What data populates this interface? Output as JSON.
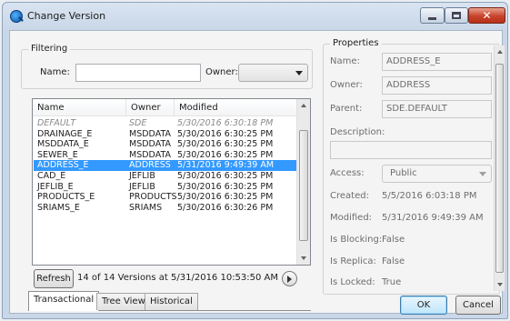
{
  "window": {
    "title": "Change Version",
    "colors": {
      "accent": "#3399ff",
      "close": "#c7432a",
      "titlebar": "#c9d7e8"
    }
  },
  "filtering": {
    "legend": "Filtering",
    "name_label": "Name:",
    "name_value": "",
    "owner_label": "Owner:",
    "owner_value": ""
  },
  "versions": {
    "columns": [
      "Name",
      "Owner",
      "Modified"
    ],
    "rows": [
      {
        "name": "DEFAULT",
        "owner": "SDE",
        "modified": "5/30/2016 6:30:18 PM",
        "style": "italic"
      },
      {
        "name": "DRAINAGE_E",
        "owner": "MSDDATA",
        "modified": "5/30/2016 6:30:25 PM",
        "style": "normal"
      },
      {
        "name": "MSDDATA_E",
        "owner": "MSDDATA",
        "modified": "5/30/2016 6:30:25 PM",
        "style": "normal"
      },
      {
        "name": "SEWER_E",
        "owner": "MSDDATA",
        "modified": "5/30/2016 6:30:25 PM",
        "style": "normal"
      },
      {
        "name": "ADDRESS_E",
        "owner": "ADDRESS",
        "modified": "5/31/2016 9:49:39 AM",
        "style": "selected"
      },
      {
        "name": "CAD_E",
        "owner": "JEFLIB",
        "modified": "5/30/2016 6:30:25 PM",
        "style": "normal"
      },
      {
        "name": "JEFLIB_E",
        "owner": "JEFLIB",
        "modified": "5/30/2016 6:30:25 PM",
        "style": "normal"
      },
      {
        "name": "PRODUCTS_E",
        "owner": "PRODUCTS",
        "modified": "5/30/2016 6:30:25 PM",
        "style": "normal"
      },
      {
        "name": "SRIAMS_E",
        "owner": "SRIAMS",
        "modified": "5/30/2016 6:30:26 PM",
        "style": "normal"
      }
    ]
  },
  "status": {
    "refresh_label": "Refresh",
    "summary": "14 of 14 Versions at 5/31/2016 10:53:50 AM"
  },
  "tabs": [
    {
      "label": "Transactional",
      "active": true
    },
    {
      "label": "Tree View",
      "active": false
    },
    {
      "label": "Historical",
      "active": false
    }
  ],
  "properties": {
    "legend": "Properties",
    "name_label": "Name:",
    "name_value": "ADDRESS_E",
    "owner_label": "Owner:",
    "owner_value": "ADDRESS",
    "parent_label": "Parent:",
    "parent_value": "SDE.DEFAULT",
    "description_label": "Description:",
    "description_value": "",
    "access_label": "Access:",
    "access_value": "Public",
    "created_label": "Created:",
    "created_value": "5/5/2016 6:03:18 PM",
    "modified_label": "Modified:",
    "modified_value": "5/31/2016 9:49:39 AM",
    "is_blocking_label": "Is Blocking:",
    "is_blocking_value": "False",
    "is_replica_label": "Is Replica:",
    "is_replica_value": "False",
    "is_locked_label": "Is Locked:",
    "is_locked_value": "True"
  },
  "buttons": {
    "ok": "OK",
    "cancel": "Cancel"
  }
}
